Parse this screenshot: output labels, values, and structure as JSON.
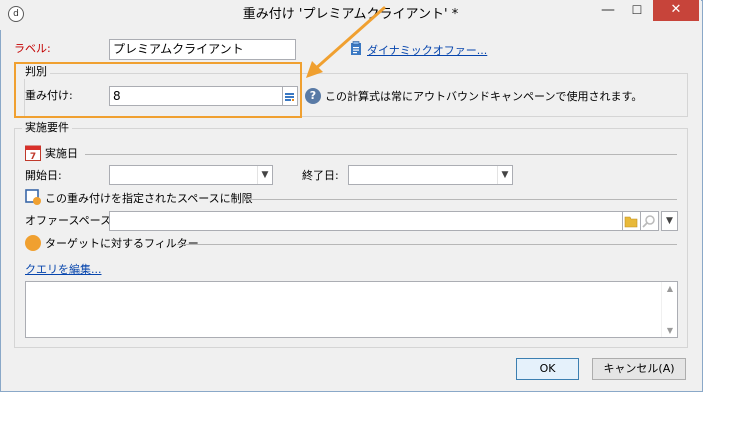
{
  "window": {
    "title": "重み付け 'プレミアムクライアント' *",
    "app_icon_glyph": "d",
    "minimize_glyph": "—",
    "maximize_glyph": "☐",
    "close_glyph": "✕"
  },
  "label_row": {
    "label": "ラベル:",
    "value": "プレミアムクライアント",
    "dynamic_offer_link": "ダイナミックオファー..."
  },
  "decision_group": {
    "title": "判別",
    "weight_label": "重み付け:",
    "weight_value": "8",
    "help_text": "この計算式は常にアウトバウンドキャンペーンで使用されます。",
    "help_glyph": "?"
  },
  "requirements_group": {
    "title": "実施要件",
    "date_section": {
      "title": "実施日",
      "calendar_glyph": "7",
      "start_label": "開始日:",
      "start_value": "",
      "end_label": "終了日:",
      "end_value": ""
    },
    "space_section": {
      "title": "この重み付けを指定されたスペースに制限",
      "space_label": "オファースペース:",
      "space_value": ""
    },
    "filter_section": {
      "title": "ターゲットに対するフィルター",
      "edit_query_link": "クエリを編集..."
    }
  },
  "buttons": {
    "ok": "OK",
    "cancel": "キャンセル(A)"
  },
  "colors": {
    "highlight": "#f0a030",
    "close_button": "#c7443a",
    "label_red": "#c40000",
    "link": "#0645ad"
  }
}
